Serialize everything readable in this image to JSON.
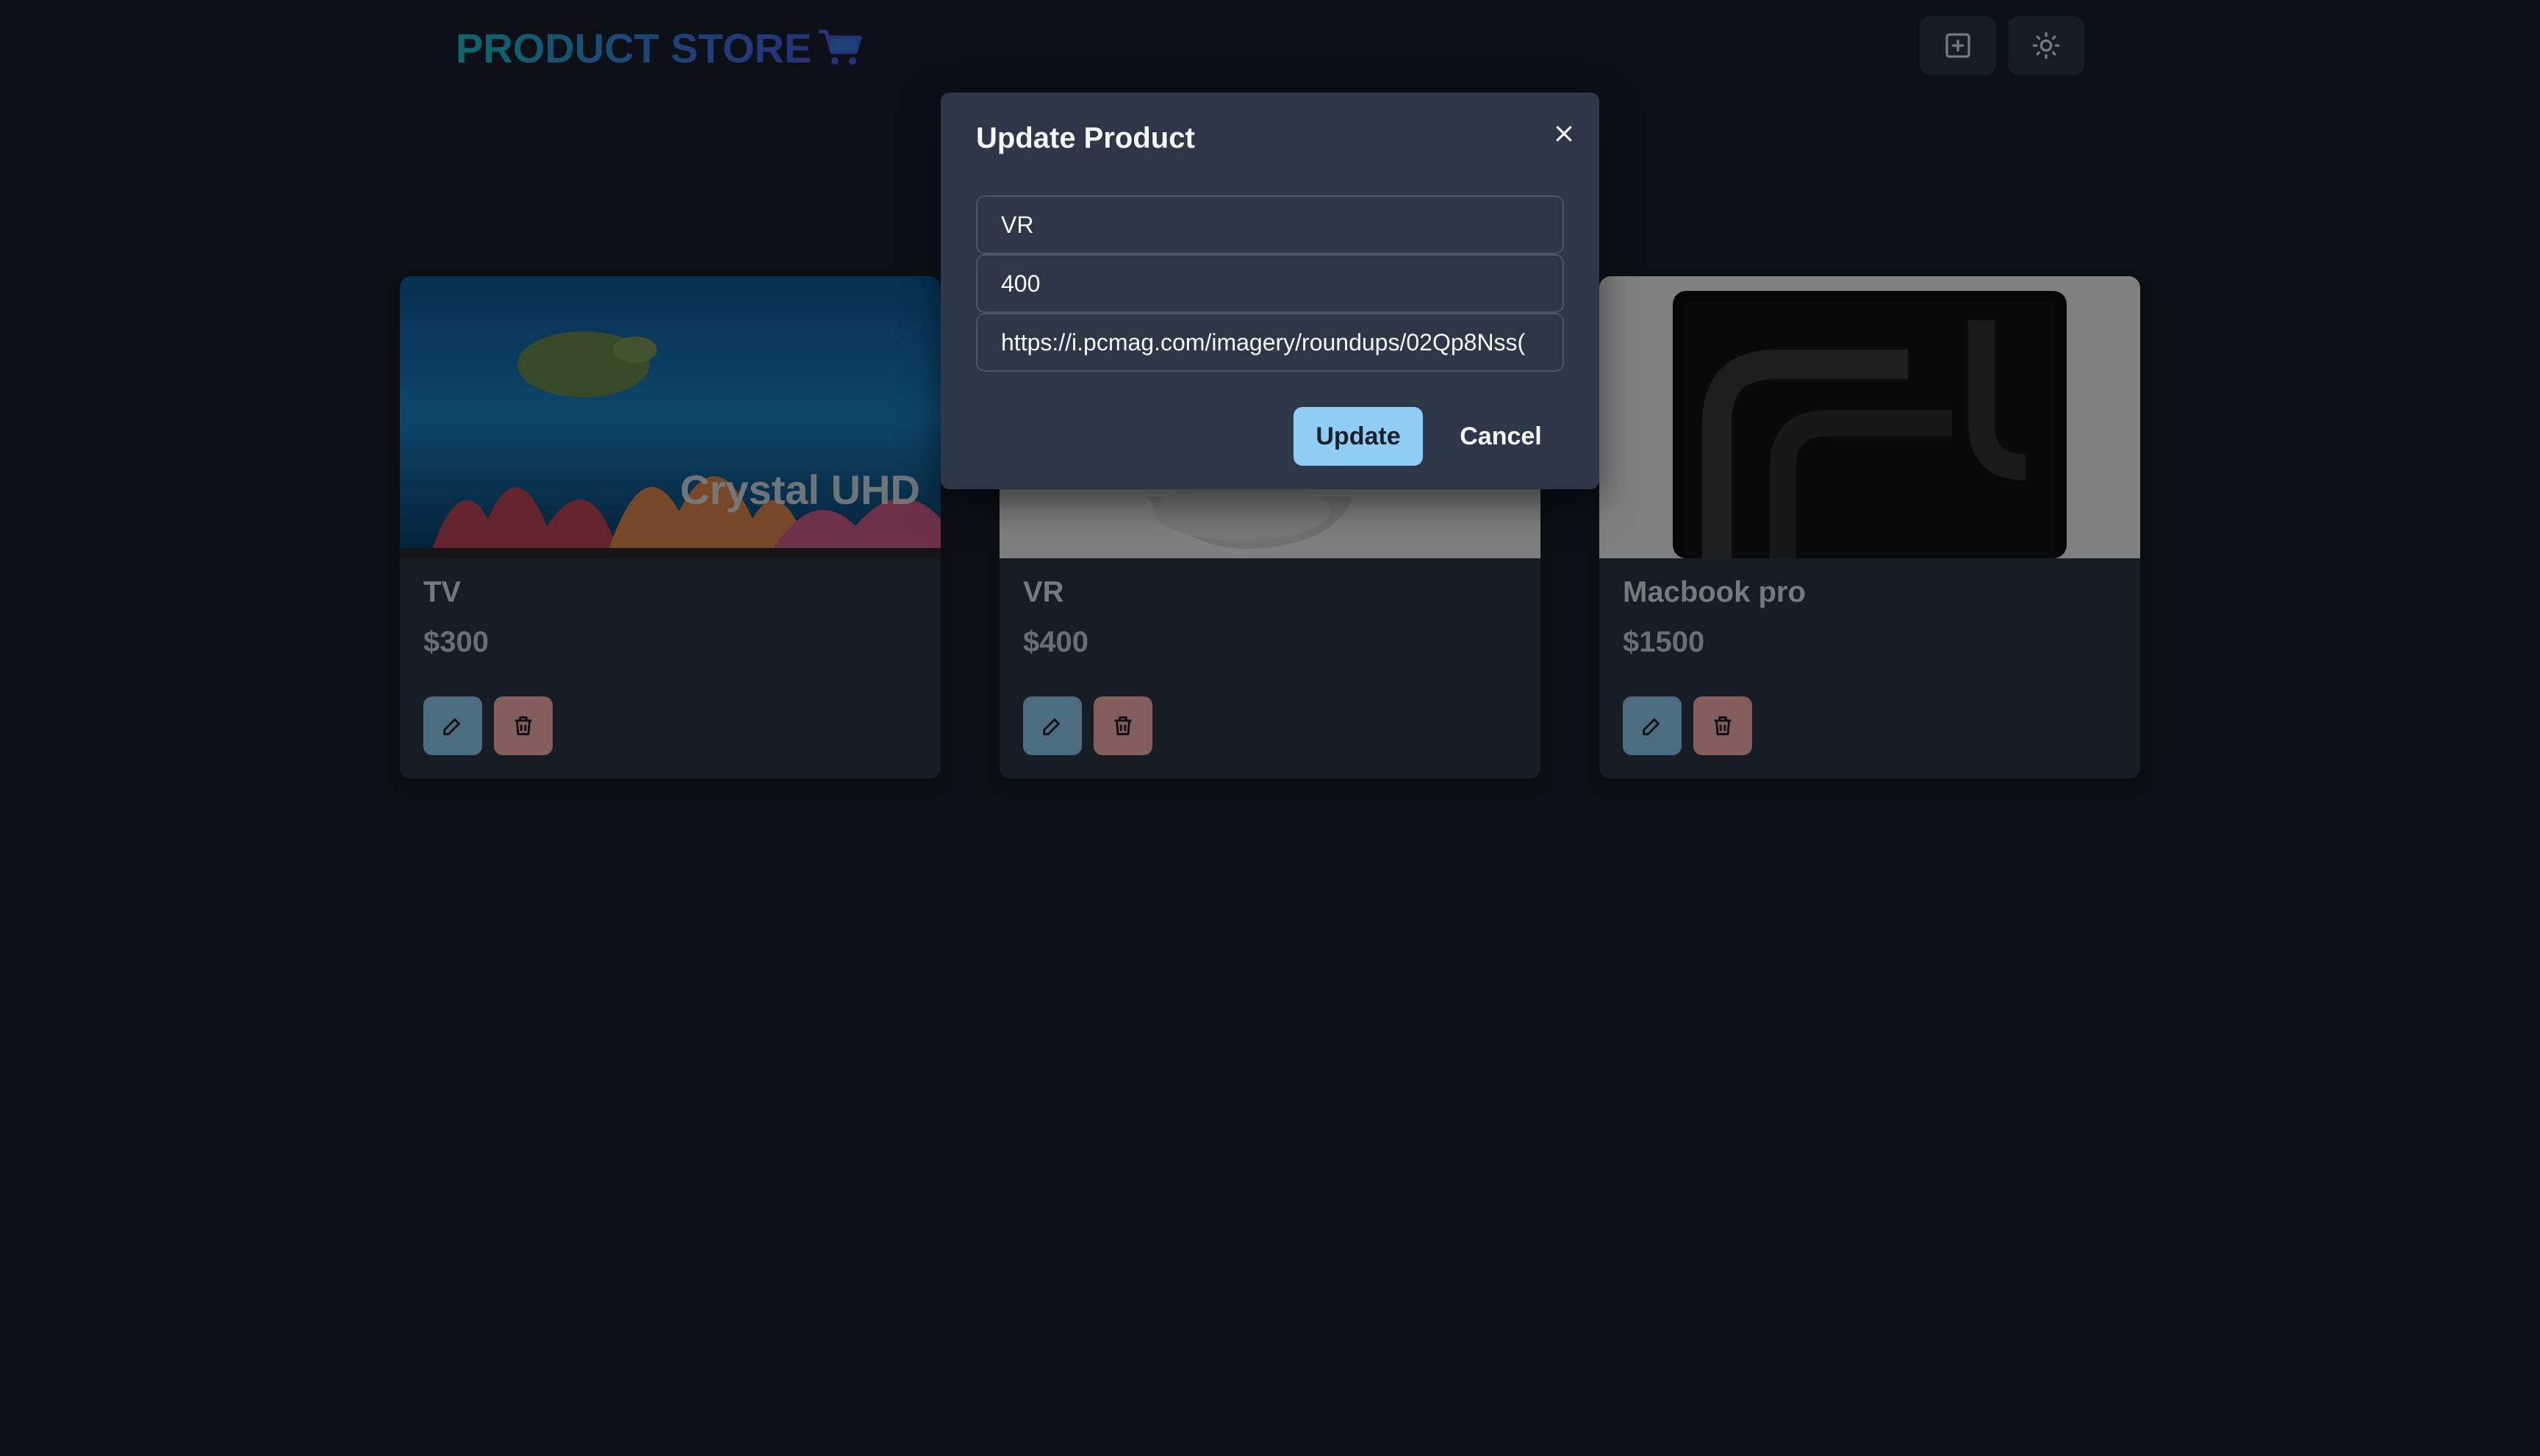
{
  "app": {
    "title": "PRODUCT STORE",
    "cart_icon": "cart-icon"
  },
  "navbar": {
    "create_button_icon": "plus-square-icon",
    "theme_toggle_icon": "sun-icon"
  },
  "products": [
    {
      "name": "TV",
      "price": "$300",
      "image_desc": "tv-image",
      "edit_icon": "edit-icon",
      "delete_icon": "trash-icon"
    },
    {
      "name": "VR",
      "price": "$400",
      "image_desc": "vr-headset-image",
      "edit_icon": "edit-icon",
      "delete_icon": "trash-icon"
    },
    {
      "name": "Macbook pro",
      "price": "$1500",
      "image_desc": "laptop-image",
      "edit_icon": "edit-icon",
      "delete_icon": "trash-icon"
    }
  ],
  "modal": {
    "title": "Update Product",
    "close_icon": "close-icon",
    "fields": {
      "name": "VR",
      "price": "400",
      "image": "https://i.pcmag.com/imagery/roundups/02Qp8Nss("
    },
    "update_label": "Update",
    "cancel_label": "Cancel"
  },
  "tv_image_text": "Crystal UHD",
  "colors": {
    "background": "#1a202c",
    "card": "#2d3748",
    "accent_blue": "#90cdf4",
    "accent_red": "#feb2b2",
    "logo_gradient_start": "#1cc8d6",
    "logo_gradient_end": "#4a63ee"
  }
}
